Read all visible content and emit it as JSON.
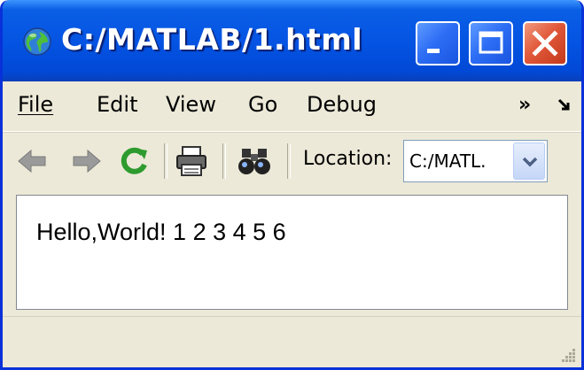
{
  "window": {
    "title": "C:/MATLAB/1.html",
    "icon": "globe-icon",
    "caption_buttons": [
      "minimize-icon",
      "maximize-icon",
      "close-icon"
    ]
  },
  "menu": {
    "items": [
      {
        "label": "File",
        "accel": "F"
      },
      {
        "label": "Edit",
        "accel": "E"
      },
      {
        "label": "View",
        "accel": "V"
      },
      {
        "label": "Go",
        "accel": "G"
      },
      {
        "label": "Debug",
        "accel": "b"
      }
    ],
    "overflow": "»"
  },
  "toolbar": {
    "icons": [
      "back-icon",
      "forward-icon",
      "refresh-icon",
      "print-icon",
      "find-icon"
    ],
    "location_label": "Location:",
    "location_value": "C:/MATL."
  },
  "content": {
    "text": "Hello,World! 1 2 3 4 5 6"
  },
  "colors": {
    "titlebar": "#0554e3",
    "close_button": "#e2583a",
    "chrome": "#ece9d8",
    "refresh_green": "#2e9b2e"
  }
}
